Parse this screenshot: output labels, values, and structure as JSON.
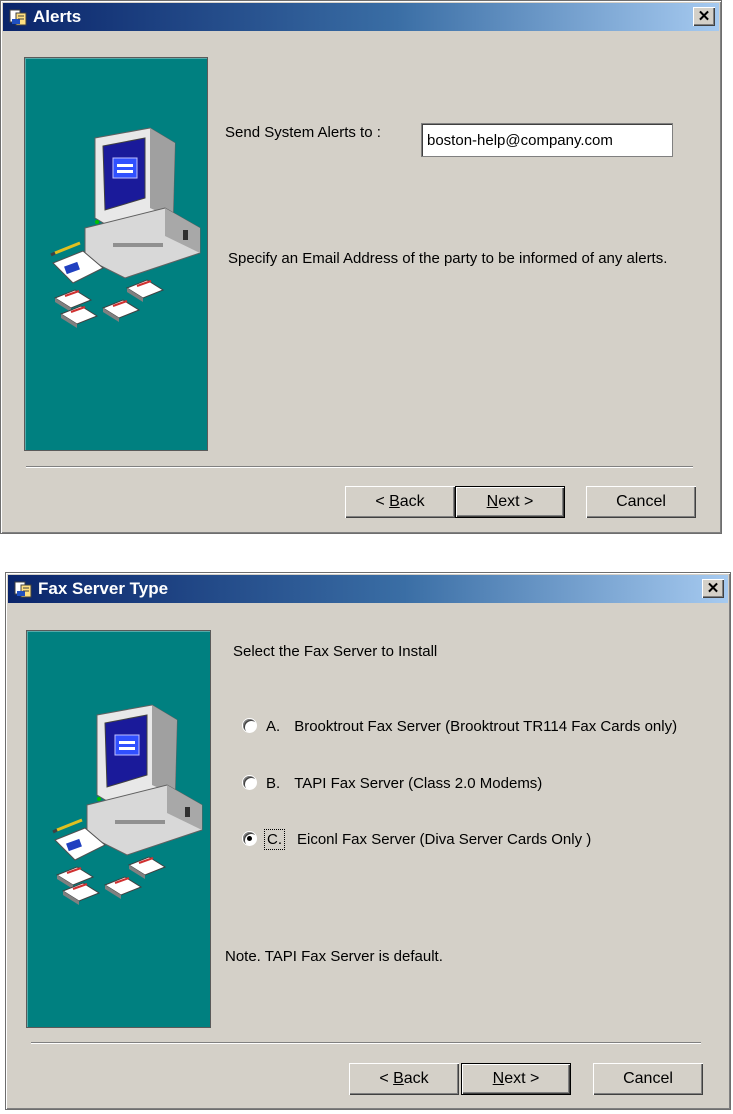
{
  "alerts_dialog": {
    "title": "Alerts",
    "close_glyph": "✕",
    "icon": "setup-icon",
    "alerts_label": "Send System Alerts to :",
    "email_value": "boston-help@company.com",
    "description": "Specify an Email Address of the party to be informed of any alerts.",
    "buttons": {
      "back": "Back",
      "back_mn": "B",
      "next": "Next",
      "next_mn": "N",
      "cancel": "Cancel"
    }
  },
  "fax_dialog": {
    "title": "Fax Server Type",
    "close_glyph": "✕",
    "icon": "setup-icon",
    "heading": "Select the Fax Server to Install",
    "options": [
      {
        "letter": "A.",
        "label": "Brooktrout Fax Server (Brooktrout TR114 Fax Cards only)",
        "checked": false
      },
      {
        "letter": "B.",
        "label": "TAPI Fax Server (Class 2.0 Modems)",
        "checked": false
      },
      {
        "letter": "C.",
        "label": "Eiconl Fax Server (Diva Server Cards Only )",
        "checked": true
      }
    ],
    "note": "Note. TAPI Fax Server is default.",
    "buttons": {
      "back": "Back",
      "back_mn": "B",
      "next": "Next",
      "next_mn": "N",
      "cancel": "Cancel"
    }
  },
  "colors": {
    "title_bar": "#0a246a",
    "panel": "#008080",
    "dialog_face": "#d4d0c8"
  }
}
